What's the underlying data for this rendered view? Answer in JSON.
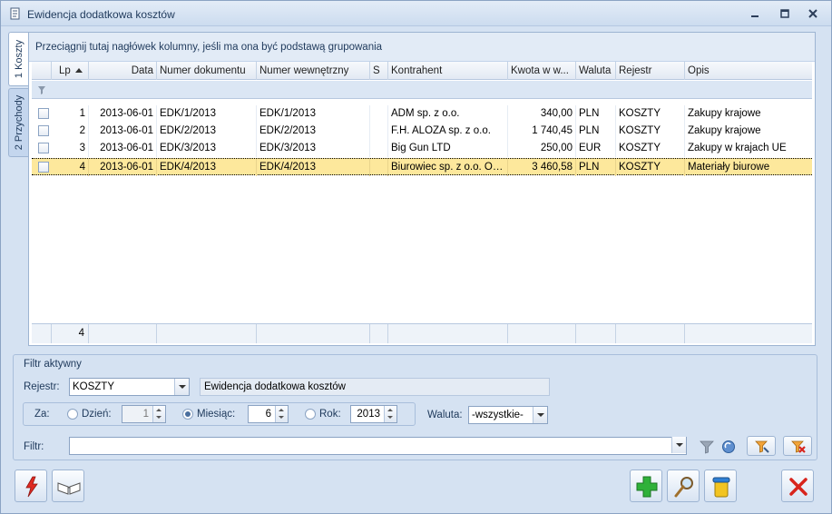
{
  "window": {
    "title": "Ewidencja dodatkowa kosztów"
  },
  "tabs": [
    {
      "label": "1 Koszty",
      "active": true
    },
    {
      "label": "2 Przychody",
      "active": false
    }
  ],
  "grid": {
    "group_hint": "Przeciągnij tutaj nagłówek kolumny, jeśli ma ona być podstawą grupowania",
    "columns": [
      "Lp",
      "Data",
      "Numer dokumentu",
      "Numer wewnętrzny",
      "S",
      "Kontrahent",
      "Kwota w w...",
      "Waluta",
      "Rejestr",
      "Opis"
    ],
    "sort_column": "Lp",
    "rows": [
      {
        "lp": "1",
        "data": "2013-06-01",
        "numer_dokumentu": "EDK/1/2013",
        "numer_wewnetrzny": "EDK/1/2013",
        "s": "",
        "kontrahent": "ADM sp. z o.o.",
        "kwota": "340,00",
        "waluta": "PLN",
        "rejestr": "KOSZTY",
        "opis": "Zakupy krajowe"
      },
      {
        "lp": "2",
        "data": "2013-06-01",
        "numer_dokumentu": "EDK/2/2013",
        "numer_wewnetrzny": "EDK/2/2013",
        "s": "",
        "kontrahent": "F.H. ALOZA sp. z o.o.",
        "kwota": "1 740,45",
        "waluta": "PLN",
        "rejestr": "KOSZTY",
        "opis": "Zakupy krajowe"
      },
      {
        "lp": "3",
        "data": "2013-06-01",
        "numer_dokumentu": "EDK/3/2013",
        "numer_wewnetrzny": "EDK/3/2013",
        "s": "",
        "kontrahent": "Big Gun LTD",
        "kwota": "250,00",
        "waluta": "EUR",
        "rejestr": "KOSZTY",
        "opis": "Zakupy w krajach UE"
      },
      {
        "lp": "4",
        "data": "2013-06-01",
        "numer_dokumentu": "EDK/4/2013",
        "numer_wewnetrzny": "EDK/4/2013",
        "s": "",
        "kontrahent": "Biurowiec sp. z o.o. Od...",
        "kwota": "3 460,58",
        "waluta": "PLN",
        "rejestr": "KOSZTY",
        "opis": "Materiały biurowe",
        "selected": true
      }
    ],
    "footer_count": "4"
  },
  "filter": {
    "section_title": "Filtr aktywny",
    "rejestr_label": "Rejestr:",
    "rejestr_value": "KOSZTY",
    "rejestr_desc": "Ewidencja dodatkowa kosztów",
    "za_label": "Za:",
    "dzien_label": "Dzień:",
    "dzien_value": "1",
    "miesiac_label": "Miesiąc:",
    "miesiac_value": "6",
    "rok_label": "Rok:",
    "rok_value": "2013",
    "period_selected": "Miesiąc",
    "waluta_label": "Waluta:",
    "waluta_value": "-wszystkie-",
    "filtr_label": "Filtr:",
    "filtr_value": ""
  },
  "colors": {
    "selected_row": "#fde89c",
    "window_bg": "#d5e2f2",
    "accent": "#1e395b"
  },
  "icons": {
    "title": "document-icon",
    "apply_filter": "funnel-icon",
    "constructor": "filter-wizard-icon",
    "clear_filter": "clear-filter-icon",
    "lightning": "lightning-icon",
    "book": "book-icon",
    "add": "plus-icon",
    "preview": "magnifier-icon",
    "delete": "trash-icon",
    "close": "close-x-icon"
  }
}
